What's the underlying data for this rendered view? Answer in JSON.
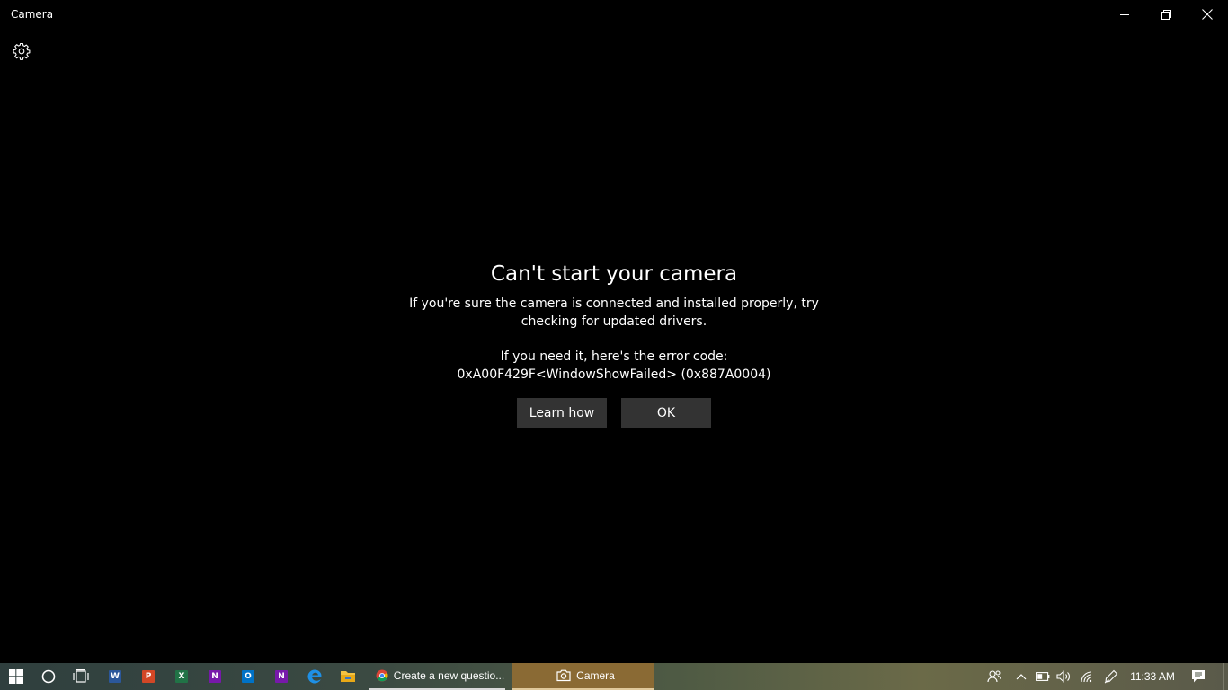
{
  "window": {
    "title": "Camera",
    "controls": {
      "minimize_icon": "minimize-icon",
      "restore_icon": "restore-icon",
      "close_icon": "close-icon"
    }
  },
  "toolbar": {
    "settings_icon": "gear-icon"
  },
  "error": {
    "title": "Can't start your camera",
    "message": "If you're sure the camera is connected and installed properly, try checking for updated drivers.",
    "code_label": "If you need it, here's the error code:",
    "code": "0xA00F429F<WindowShowFailed> (0x887A0004)",
    "buttons": {
      "learn_how": "Learn how",
      "ok": "OK"
    }
  },
  "taskbar": {
    "start_icon": "windows-start-icon",
    "search_icon": "cortana-circle-icon",
    "task_view_icon": "task-view-icon",
    "pinned": [
      {
        "name": "word",
        "glyph": "W",
        "color": "#2b579a"
      },
      {
        "name": "powerpoint",
        "glyph": "P",
        "color": "#d24726"
      },
      {
        "name": "excel",
        "glyph": "X",
        "color": "#217346"
      },
      {
        "name": "onenote",
        "glyph": "N",
        "color": "#7719aa"
      },
      {
        "name": "outlook",
        "glyph": "O",
        "color": "#0072c6"
      },
      {
        "name": "onenote-2",
        "glyph": "N",
        "color": "#7719aa"
      }
    ],
    "edge_icon": "edge-icon",
    "explorer_icon": "file-explorer-icon",
    "windows": [
      {
        "label": "Create a new questio...",
        "icon": "chrome-icon"
      },
      {
        "label": "Camera",
        "icon": "camera-icon",
        "active": true
      }
    ],
    "tray": {
      "people_icon": "people-icon",
      "chevron_icon": "chevron-up-icon",
      "battery_icon": "battery-icon",
      "volume_icon": "volume-icon",
      "wifi_icon": "wifi-icon",
      "pen_icon": "pen-ink-icon",
      "time": "11:33 AM",
      "notifications_icon": "action-center-icon"
    },
    "accent_color": "#8a6a34"
  }
}
